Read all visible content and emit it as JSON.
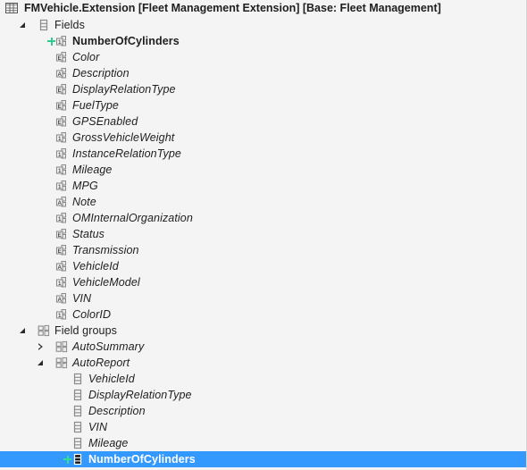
{
  "window": {
    "title": "FMVehicle.Extension [Fleet Management Extension] [Base: Fleet Management]",
    "title_icon": "table-icon",
    "background_color": "#f4f4f4",
    "selection_color": "#3399ff",
    "added_badge_color": "#2ecc8f"
  },
  "tree": {
    "nodes": [
      {
        "label": "Fields",
        "indent": 1,
        "icon": "fields-node-icon",
        "expander": "expanded",
        "added": false,
        "italic": false,
        "bold": false,
        "selected": false
      },
      {
        "label": "NumberOfCylinders",
        "indent": 2,
        "icon": "field-int-icon",
        "expander": "none",
        "added": true,
        "italic": false,
        "bold": true,
        "selected": false
      },
      {
        "label": "Color",
        "indent": 2,
        "icon": "field-enum-icon",
        "expander": "none",
        "added": false,
        "italic": true,
        "bold": false,
        "selected": false
      },
      {
        "label": "Description",
        "indent": 2,
        "icon": "field-string-icon",
        "expander": "none",
        "added": false,
        "italic": true,
        "bold": false,
        "selected": false
      },
      {
        "label": "DisplayRelationType",
        "indent": 2,
        "icon": "field-enum-icon",
        "expander": "none",
        "added": false,
        "italic": true,
        "bold": false,
        "selected": false
      },
      {
        "label": "FuelType",
        "indent": 2,
        "icon": "field-enum-icon",
        "expander": "none",
        "added": false,
        "italic": true,
        "bold": false,
        "selected": false
      },
      {
        "label": "GPSEnabled",
        "indent": 2,
        "icon": "field-enum-icon",
        "expander": "none",
        "added": false,
        "italic": true,
        "bold": false,
        "selected": false
      },
      {
        "label": "GrossVehicleWeight",
        "indent": 2,
        "icon": "field-int-icon",
        "expander": "none",
        "added": false,
        "italic": true,
        "bold": false,
        "selected": false
      },
      {
        "label": "InstanceRelationType",
        "indent": 2,
        "icon": "field-int-icon",
        "expander": "none",
        "added": false,
        "italic": true,
        "bold": false,
        "selected": false
      },
      {
        "label": "Mileage",
        "indent": 2,
        "icon": "field-int-icon",
        "expander": "none",
        "added": false,
        "italic": true,
        "bold": false,
        "selected": false
      },
      {
        "label": "MPG",
        "indent": 2,
        "icon": "field-int-icon",
        "expander": "none",
        "added": false,
        "italic": true,
        "bold": false,
        "selected": false
      },
      {
        "label": "Note",
        "indent": 2,
        "icon": "field-string-icon",
        "expander": "none",
        "added": false,
        "italic": true,
        "bold": false,
        "selected": false
      },
      {
        "label": "OMInternalOrganization",
        "indent": 2,
        "icon": "field-int-icon",
        "expander": "none",
        "added": false,
        "italic": true,
        "bold": false,
        "selected": false
      },
      {
        "label": "Status",
        "indent": 2,
        "icon": "field-enum-icon",
        "expander": "none",
        "added": false,
        "italic": true,
        "bold": false,
        "selected": false
      },
      {
        "label": "Transmission",
        "indent": 2,
        "icon": "field-enum-icon",
        "expander": "none",
        "added": false,
        "italic": true,
        "bold": false,
        "selected": false
      },
      {
        "label": "VehicleId",
        "indent": 2,
        "icon": "field-string-icon",
        "expander": "none",
        "added": false,
        "italic": true,
        "bold": false,
        "selected": false
      },
      {
        "label": "VehicleModel",
        "indent": 2,
        "icon": "field-int-icon",
        "expander": "none",
        "added": false,
        "italic": true,
        "bold": false,
        "selected": false
      },
      {
        "label": "VIN",
        "indent": 2,
        "icon": "field-string-icon",
        "expander": "none",
        "added": false,
        "italic": true,
        "bold": false,
        "selected": false
      },
      {
        "label": "ColorID",
        "indent": 2,
        "icon": "field-int-icon",
        "expander": "none",
        "added": false,
        "italic": true,
        "bold": false,
        "selected": false
      },
      {
        "label": "Field groups",
        "indent": 1,
        "icon": "field-groups-node-icon",
        "expander": "expanded",
        "added": false,
        "italic": false,
        "bold": false,
        "selected": false
      },
      {
        "label": "AutoSummary",
        "indent": 2,
        "icon": "field-group-icon",
        "expander": "collapsed",
        "added": false,
        "italic": true,
        "bold": false,
        "selected": false
      },
      {
        "label": "AutoReport",
        "indent": 2,
        "icon": "field-group-icon",
        "expander": "expanded",
        "added": false,
        "italic": true,
        "bold": false,
        "selected": false
      },
      {
        "label": "VehicleId",
        "indent": 3,
        "icon": "group-member-icon",
        "expander": "none",
        "added": false,
        "italic": true,
        "bold": false,
        "selected": false
      },
      {
        "label": "DisplayRelationType",
        "indent": 3,
        "icon": "group-member-icon",
        "expander": "none",
        "added": false,
        "italic": true,
        "bold": false,
        "selected": false
      },
      {
        "label": "Description",
        "indent": 3,
        "icon": "group-member-icon",
        "expander": "none",
        "added": false,
        "italic": true,
        "bold": false,
        "selected": false
      },
      {
        "label": "VIN",
        "indent": 3,
        "icon": "group-member-icon",
        "expander": "none",
        "added": false,
        "italic": true,
        "bold": false,
        "selected": false
      },
      {
        "label": "Mileage",
        "indent": 3,
        "icon": "group-member-icon",
        "expander": "none",
        "added": false,
        "italic": true,
        "bold": false,
        "selected": false
      },
      {
        "label": "NumberOfCylinders",
        "indent": 3,
        "icon": "group-member-icon",
        "expander": "none",
        "added": true,
        "italic": false,
        "bold": true,
        "selected": true
      }
    ]
  }
}
